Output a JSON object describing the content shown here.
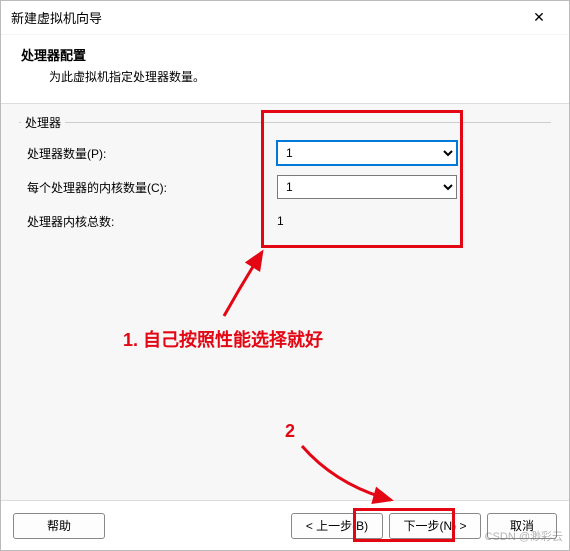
{
  "window": {
    "title": "新建虚拟机向导",
    "close_glyph": "✕"
  },
  "header": {
    "title": "处理器配置",
    "subtitle": "为此虚拟机指定处理器数量。"
  },
  "group": {
    "legend": "处理器",
    "rows": {
      "cpu_count": {
        "label": "处理器数量(P):",
        "value": "1"
      },
      "cores_per_cpu": {
        "label": "每个处理器的内核数量(C):",
        "value": "1"
      },
      "total_cores": {
        "label": "处理器内核总数:",
        "value": "1"
      }
    }
  },
  "footer": {
    "help": "帮助",
    "back": "< 上一步(B)",
    "next": "下一步(N) >",
    "cancel": "取消"
  },
  "annotations": {
    "note1": "1. 自己按照性能选择就好",
    "note2": "2"
  },
  "watermark": "CSDN @渺彩云"
}
